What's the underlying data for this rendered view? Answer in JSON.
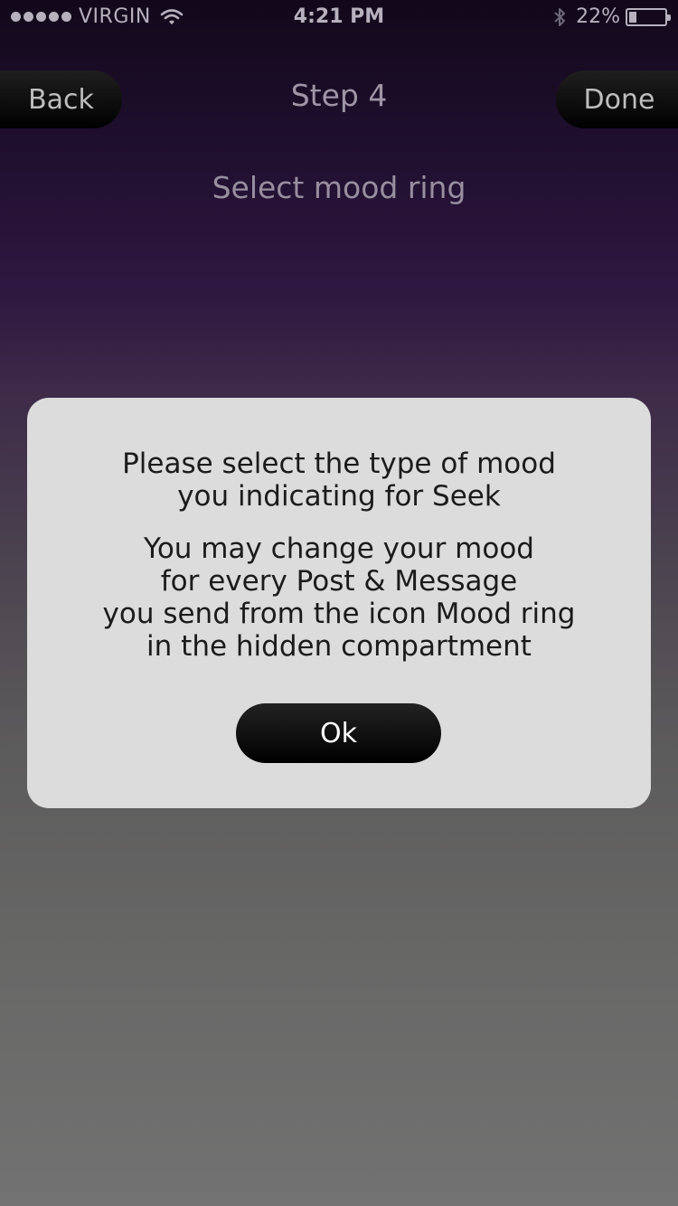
{
  "status_bar": {
    "carrier": "VIRGIN",
    "time": "4:21 PM",
    "battery_percent": "22%",
    "battery_level": 0.22,
    "icons": [
      "signal-dots",
      "wifi-icon",
      "bluetooth-icon",
      "battery-icon"
    ]
  },
  "nav": {
    "back_label": "Back",
    "title": "Step 4",
    "done_label": "Done"
  },
  "page": {
    "subtitle": "Select mood ring"
  },
  "dialog": {
    "message1_lines": [
      "Please select the type of mood",
      "you indicating for Seek"
    ],
    "message2_lines": [
      "You may change your mood",
      "for every Post & Message",
      "you send from the icon Mood ring",
      "in the hidden compartment"
    ],
    "ok_label": "Ok"
  },
  "colors": {
    "background_top": "#12081a",
    "background_bottom": "#727272",
    "dialog_bg": "#dcdcdc",
    "button_bg": "#000000"
  }
}
